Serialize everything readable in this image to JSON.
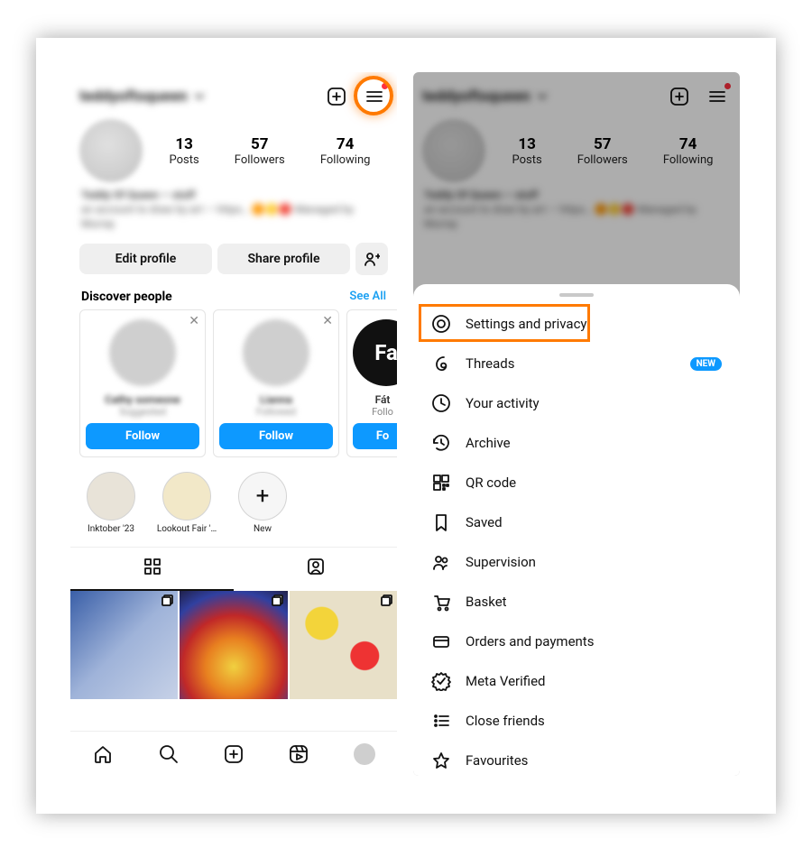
{
  "left": {
    "username": "teddyoftsqueen",
    "stats": {
      "posts": {
        "value": "13",
        "label": "Posts"
      },
      "followers": {
        "value": "57",
        "label": "Followers"
      },
      "following": {
        "value": "74",
        "label": "Following"
      }
    },
    "bio": {
      "line1": "Teddy Of Queen — stuff",
      "line2": "an account to draw by art — https… 🟠🟡🔴 Managed by",
      "line3": "Murray"
    },
    "buttons": {
      "edit": "Edit profile",
      "share": "Share profile"
    },
    "discover": {
      "title": "Discover people",
      "see_all": "See All"
    },
    "cards": [
      {
        "name": "Cathy someone",
        "sub": "Suggested",
        "follow": "Follow"
      },
      {
        "name": "Lianna",
        "sub": "Followed",
        "follow": "Follow"
      },
      {
        "face": "Fa",
        "name": "Fát",
        "sub": "Follo",
        "follow": "Fo"
      }
    ],
    "highlights": [
      {
        "label": "Inktober '23"
      },
      {
        "label": "Lookout Fair '…"
      },
      {
        "label": "New"
      }
    ]
  },
  "right": {
    "badge_new": "NEW",
    "menu": [
      {
        "key": "settings",
        "label": "Settings and privacy"
      },
      {
        "key": "threads",
        "label": "Threads",
        "badge": true
      },
      {
        "key": "activity",
        "label": "Your activity"
      },
      {
        "key": "archive",
        "label": "Archive"
      },
      {
        "key": "qr",
        "label": "QR code"
      },
      {
        "key": "saved",
        "label": "Saved"
      },
      {
        "key": "supervision",
        "label": "Supervision"
      },
      {
        "key": "basket",
        "label": "Basket"
      },
      {
        "key": "orders",
        "label": "Orders and payments"
      },
      {
        "key": "verified",
        "label": "Meta Verified"
      },
      {
        "key": "close",
        "label": "Close friends"
      },
      {
        "key": "fav",
        "label": "Favourites"
      }
    ]
  }
}
